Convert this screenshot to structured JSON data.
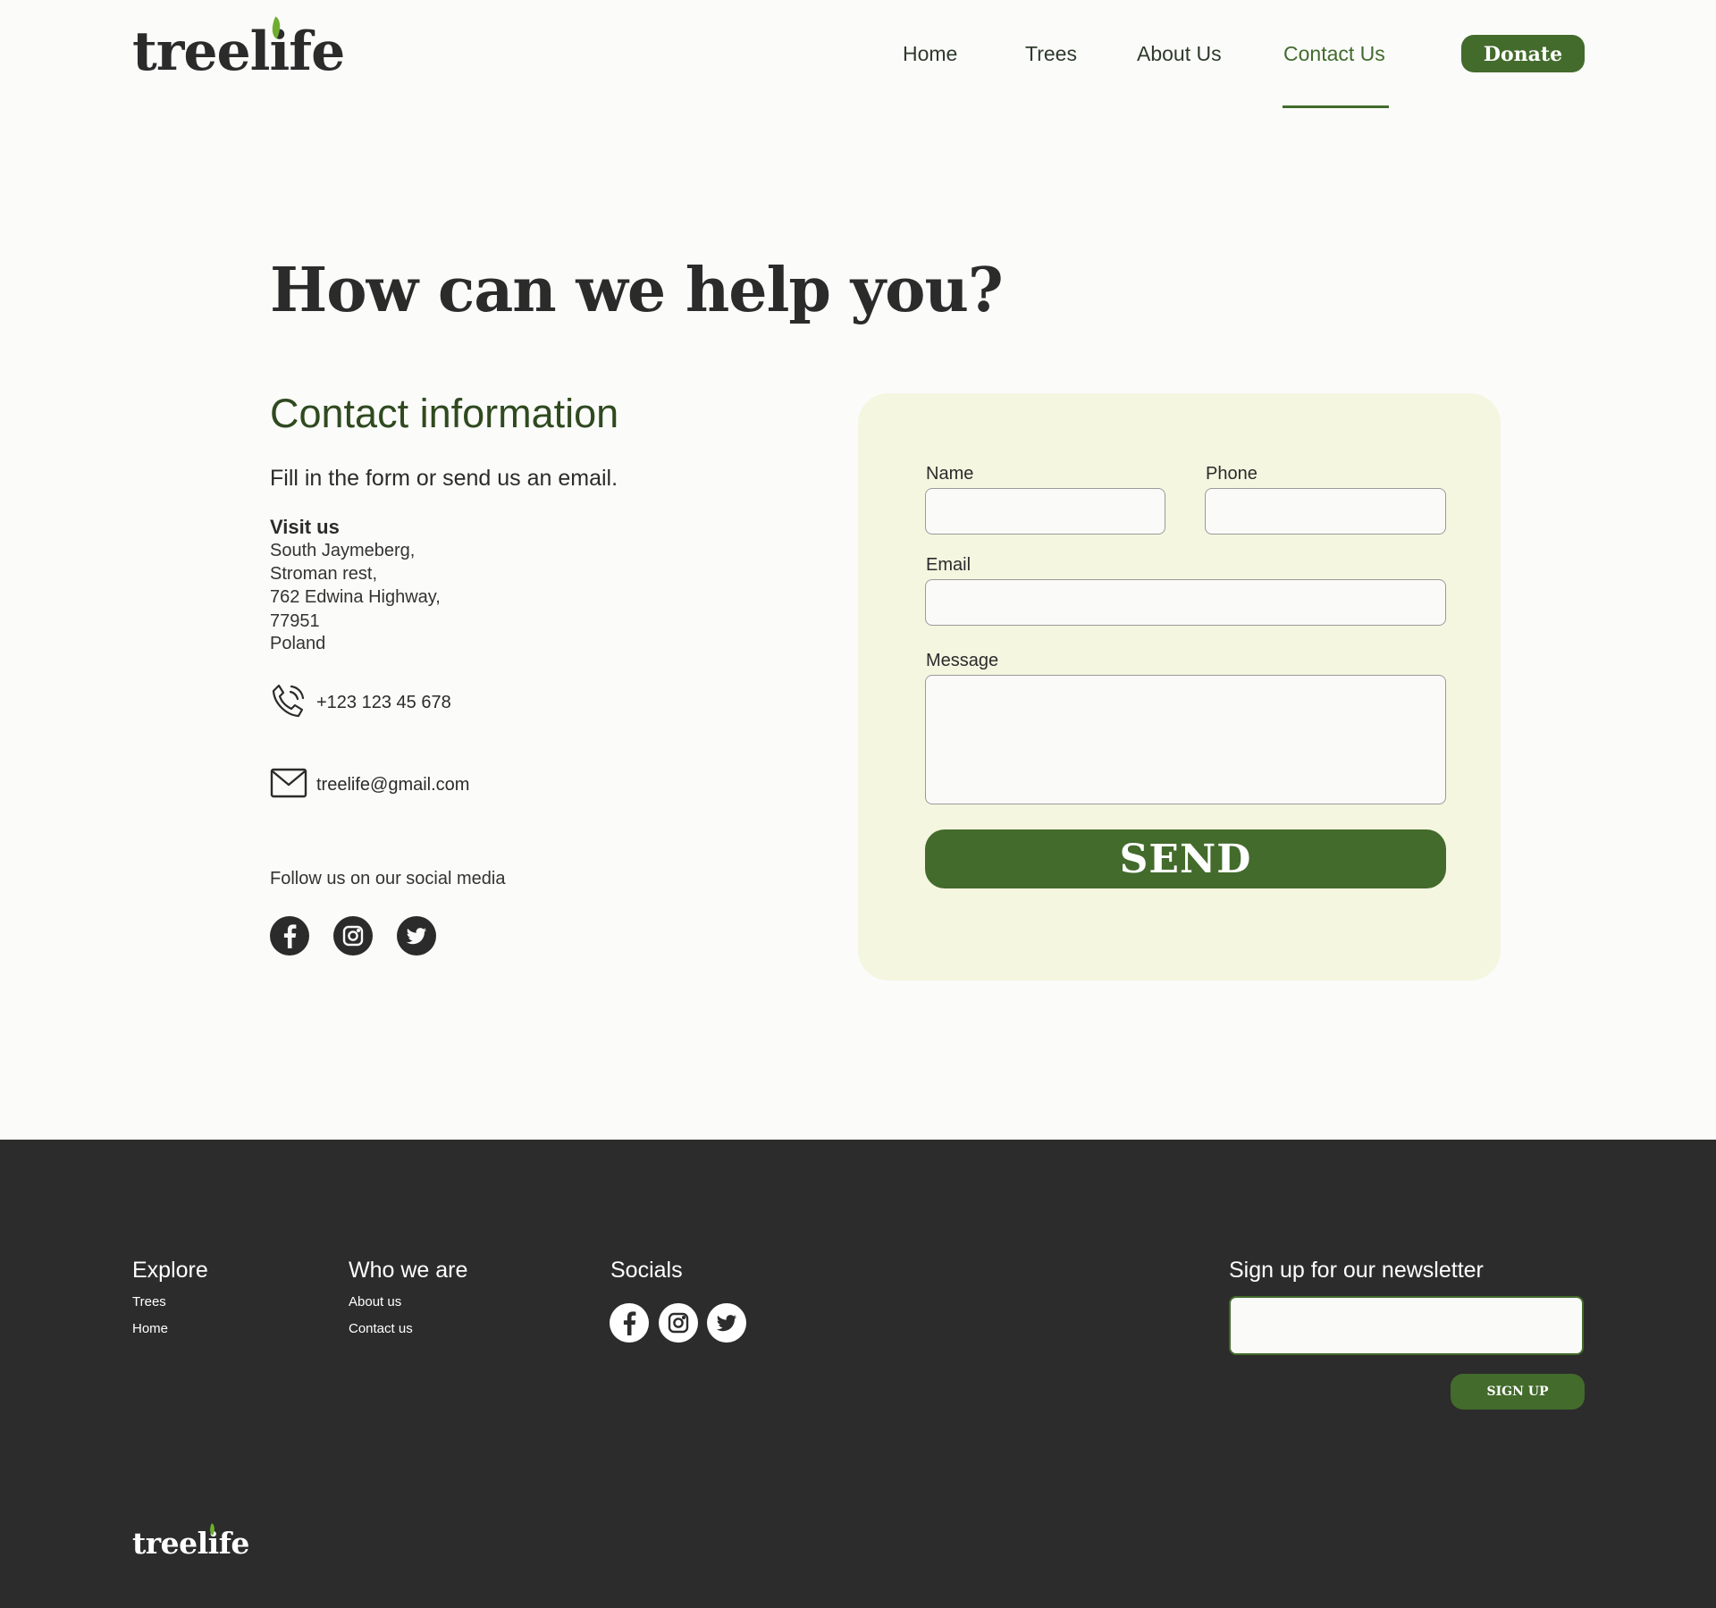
{
  "brand": {
    "name_part1": "treel",
    "name_i": "i",
    "name_part2": "fe",
    "leaf_color": "#6fad2f"
  },
  "nav": {
    "items": [
      {
        "label": "Home",
        "active": false
      },
      {
        "label": "Trees",
        "active": false
      },
      {
        "label": "About Us",
        "active": false
      },
      {
        "label": "Contact Us",
        "active": true
      }
    ],
    "donate_label": "Donate"
  },
  "main": {
    "title": "How can we help you?",
    "contact_heading": "Contact information",
    "contact_sub": "Fill in the form or send us an email.",
    "visit_title": "Visit us",
    "address": [
      "South Jaymeberg,",
      "Stroman rest,",
      "762 Edwina Highway,",
      "77951",
      "Poland"
    ],
    "phone": "+123 123 45 678",
    "email": "treelife@gmail.com",
    "follow_text": "Follow us on our social media",
    "socials": [
      "facebook-icon",
      "instagram-icon",
      "twitter-icon"
    ]
  },
  "form": {
    "name_label": "Name",
    "name_value": "",
    "phone_label": "Phone",
    "phone_value": "",
    "email_label": "Email",
    "email_value": "",
    "message_label": "Message",
    "message_value": "",
    "send_label": "SEND"
  },
  "footer": {
    "explore": {
      "heading": "Explore",
      "links": [
        "Trees",
        "Home"
      ]
    },
    "who": {
      "heading": "Who we are",
      "links": [
        "About us",
        "Contact us"
      ]
    },
    "socials_heading": "Socials",
    "newsletter": {
      "heading": "Sign up for our newsletter",
      "value": "",
      "button_label": "SIGN UP"
    }
  },
  "colors": {
    "accent": "#436b2c",
    "background": "#fbfbfa",
    "footer_bg": "#2c2c2c",
    "form_bg": "#f4f6e0"
  }
}
